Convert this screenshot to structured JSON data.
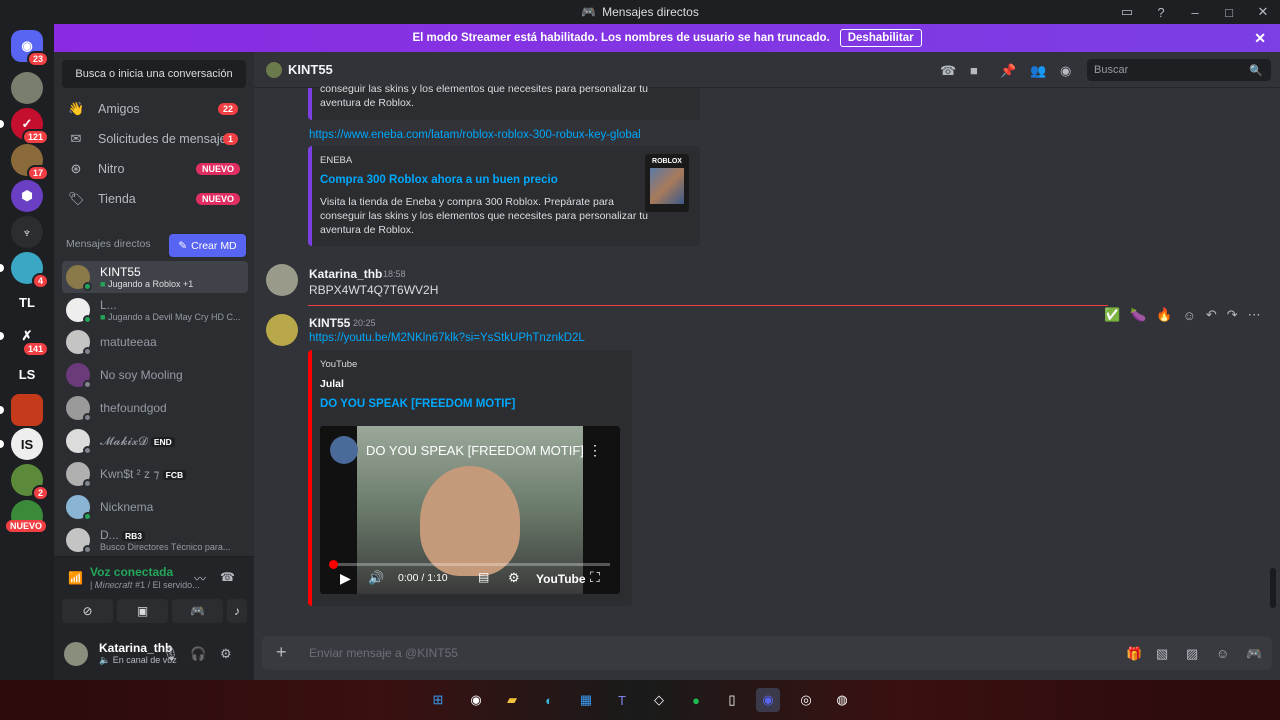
{
  "window": {
    "title": "Mensajes directos"
  },
  "banner": {
    "text": "El modo Streamer está habilitado. Los nombres de usuario se han truncado.",
    "button": "Deshabilitar"
  },
  "servers": {
    "home_badge": "23",
    "items": [
      {
        "badge": "121"
      },
      {
        "badge": "17"
      },
      {
        "badge": ""
      },
      {
        "badge": ""
      },
      {
        "badge": "4"
      },
      {
        "label": "TL"
      },
      {
        "badge": "141"
      },
      {
        "label": "LS"
      },
      {
        "badge": ""
      },
      {
        "badge": ""
      },
      {
        "badge": "2"
      },
      {
        "badge": "NUEVO"
      }
    ]
  },
  "dm_sidebar": {
    "search_placeholder": "Busca o inicia una conversación",
    "nav": [
      {
        "label": "Amigos",
        "badge": "22"
      },
      {
        "label": "Solicitudes de mensajes",
        "badge": "1"
      },
      {
        "label": "Nitro",
        "badge": "NUEVO"
      },
      {
        "label": "Tienda",
        "badge": "NUEVO"
      }
    ],
    "header": "Mensajes directos",
    "create_button": "Crear MD",
    "dms": [
      {
        "name": "KINT55",
        "sub": "Jugando a Roblox +1"
      },
      {
        "name": "L...",
        "sub": "Jugando a Devil May Cry HD C..."
      },
      {
        "name": "matuteeaa",
        "sub": ""
      },
      {
        "name": "No soy Mooling",
        "sub": ""
      },
      {
        "name": "thefoundgod",
        "sub": ""
      },
      {
        "name": "𝓜𝓪𝓴𝓲𝔁𝓓",
        "tag": "END",
        "sub": ""
      },
      {
        "name": "Kwn$t ² z ⁊",
        "tag": "FCB",
        "sub": ""
      },
      {
        "name": "Nicknema",
        "sub": ""
      },
      {
        "name": "D...",
        "tag": "RB3",
        "sub": "Busco Directores Técnico para..."
      }
    ]
  },
  "voice": {
    "status": "Voz conectada",
    "server": "| 𝑀𝑖𝑛𝑒𝑐𝑟𝑎𝑓𝑡 #1 / El servido..."
  },
  "user": {
    "name": "Katarina_thb",
    "status": "En canal de voz"
  },
  "channel": {
    "name": "KINT55",
    "search_placeholder": "Buscar"
  },
  "messages": {
    "embed1_desc_tail": [
      "conseguir las skins y los elementos que necesites para personalizar tu",
      "aventura de Roblox."
    ],
    "link1": "https://www.eneba.com/latam/roblox-roblox-300-robux-key-global",
    "embed2": {
      "provider": "ENEBA",
      "title": "Compra 300 Roblox ahora a un buen precio",
      "desc": [
        "Visita la tienda de Eneba y compra 300 Roblox. Prepárate para",
        "conseguir las skins y los elementos que necesites para personalizar tu",
        "aventura de Roblox."
      ],
      "thumb": "ROBLOX"
    },
    "msg1": {
      "author": "Katarina_thb",
      "time": "18:58",
      "text": "RBPX4WT4Q7T6WV2H"
    },
    "msg2": {
      "author": "KINT55",
      "time": "20:25",
      "link": "https://youtu.be/M2NKln67klk?si=YsStkUPhTnznkD2L"
    },
    "yt": {
      "provider": "YouTube",
      "author": "Julal",
      "title": "DO YOU SPEAK [FREEDOM MOTIF]",
      "video_title": "DO YOU SPEAK [FREEDOM MOTIF]",
      "time": "0:00 / 1:10",
      "brand": "YouTube"
    }
  },
  "composer": {
    "placeholder": "Enviar mensaje a @KINT55"
  }
}
